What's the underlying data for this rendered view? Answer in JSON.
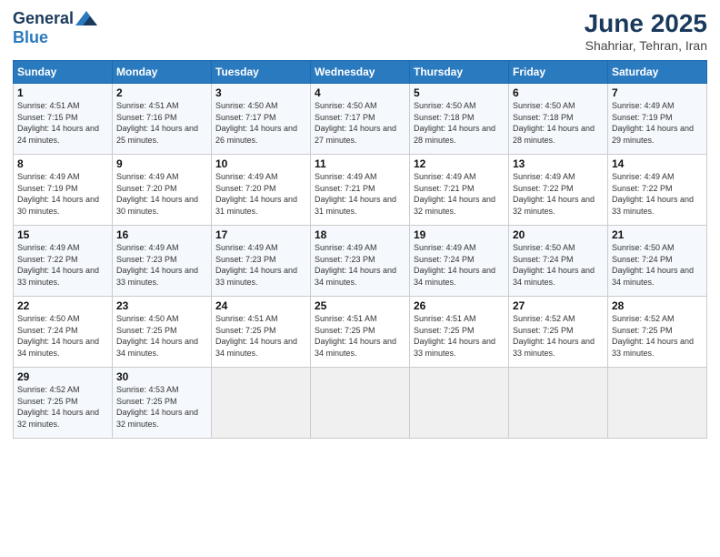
{
  "header": {
    "logo_line1": "General",
    "logo_line2": "Blue",
    "month_title": "June 2025",
    "subtitle": "Shahriar, Tehran, Iran"
  },
  "days_of_week": [
    "Sunday",
    "Monday",
    "Tuesday",
    "Wednesday",
    "Thursday",
    "Friday",
    "Saturday"
  ],
  "weeks": [
    [
      {
        "day": "1",
        "sunrise": "4:51 AM",
        "sunset": "7:15 PM",
        "daylight": "14 hours and 24 minutes."
      },
      {
        "day": "2",
        "sunrise": "4:51 AM",
        "sunset": "7:16 PM",
        "daylight": "14 hours and 25 minutes."
      },
      {
        "day": "3",
        "sunrise": "4:50 AM",
        "sunset": "7:17 PM",
        "daylight": "14 hours and 26 minutes."
      },
      {
        "day": "4",
        "sunrise": "4:50 AM",
        "sunset": "7:17 PM",
        "daylight": "14 hours and 27 minutes."
      },
      {
        "day": "5",
        "sunrise": "4:50 AM",
        "sunset": "7:18 PM",
        "daylight": "14 hours and 28 minutes."
      },
      {
        "day": "6",
        "sunrise": "4:50 AM",
        "sunset": "7:18 PM",
        "daylight": "14 hours and 28 minutes."
      },
      {
        "day": "7",
        "sunrise": "4:49 AM",
        "sunset": "7:19 PM",
        "daylight": "14 hours and 29 minutes."
      }
    ],
    [
      {
        "day": "8",
        "sunrise": "4:49 AM",
        "sunset": "7:19 PM",
        "daylight": "14 hours and 30 minutes."
      },
      {
        "day": "9",
        "sunrise": "4:49 AM",
        "sunset": "7:20 PM",
        "daylight": "14 hours and 30 minutes."
      },
      {
        "day": "10",
        "sunrise": "4:49 AM",
        "sunset": "7:20 PM",
        "daylight": "14 hours and 31 minutes."
      },
      {
        "day": "11",
        "sunrise": "4:49 AM",
        "sunset": "7:21 PM",
        "daylight": "14 hours and 31 minutes."
      },
      {
        "day": "12",
        "sunrise": "4:49 AM",
        "sunset": "7:21 PM",
        "daylight": "14 hours and 32 minutes."
      },
      {
        "day": "13",
        "sunrise": "4:49 AM",
        "sunset": "7:22 PM",
        "daylight": "14 hours and 32 minutes."
      },
      {
        "day": "14",
        "sunrise": "4:49 AM",
        "sunset": "7:22 PM",
        "daylight": "14 hours and 33 minutes."
      }
    ],
    [
      {
        "day": "15",
        "sunrise": "4:49 AM",
        "sunset": "7:22 PM",
        "daylight": "14 hours and 33 minutes."
      },
      {
        "day": "16",
        "sunrise": "4:49 AM",
        "sunset": "7:23 PM",
        "daylight": "14 hours and 33 minutes."
      },
      {
        "day": "17",
        "sunrise": "4:49 AM",
        "sunset": "7:23 PM",
        "daylight": "14 hours and 33 minutes."
      },
      {
        "day": "18",
        "sunrise": "4:49 AM",
        "sunset": "7:23 PM",
        "daylight": "14 hours and 34 minutes."
      },
      {
        "day": "19",
        "sunrise": "4:49 AM",
        "sunset": "7:24 PM",
        "daylight": "14 hours and 34 minutes."
      },
      {
        "day": "20",
        "sunrise": "4:50 AM",
        "sunset": "7:24 PM",
        "daylight": "14 hours and 34 minutes."
      },
      {
        "day": "21",
        "sunrise": "4:50 AM",
        "sunset": "7:24 PM",
        "daylight": "14 hours and 34 minutes."
      }
    ],
    [
      {
        "day": "22",
        "sunrise": "4:50 AM",
        "sunset": "7:24 PM",
        "daylight": "14 hours and 34 minutes."
      },
      {
        "day": "23",
        "sunrise": "4:50 AM",
        "sunset": "7:25 PM",
        "daylight": "14 hours and 34 minutes."
      },
      {
        "day": "24",
        "sunrise": "4:51 AM",
        "sunset": "7:25 PM",
        "daylight": "14 hours and 34 minutes."
      },
      {
        "day": "25",
        "sunrise": "4:51 AM",
        "sunset": "7:25 PM",
        "daylight": "14 hours and 34 minutes."
      },
      {
        "day": "26",
        "sunrise": "4:51 AM",
        "sunset": "7:25 PM",
        "daylight": "14 hours and 33 minutes."
      },
      {
        "day": "27",
        "sunrise": "4:52 AM",
        "sunset": "7:25 PM",
        "daylight": "14 hours and 33 minutes."
      },
      {
        "day": "28",
        "sunrise": "4:52 AM",
        "sunset": "7:25 PM",
        "daylight": "14 hours and 33 minutes."
      }
    ],
    [
      {
        "day": "29",
        "sunrise": "4:52 AM",
        "sunset": "7:25 PM",
        "daylight": "14 hours and 32 minutes."
      },
      {
        "day": "30",
        "sunrise": "4:53 AM",
        "sunset": "7:25 PM",
        "daylight": "14 hours and 32 minutes."
      },
      null,
      null,
      null,
      null,
      null
    ]
  ],
  "labels": {
    "sunrise": "Sunrise:",
    "sunset": "Sunset:",
    "daylight": "Daylight:"
  }
}
